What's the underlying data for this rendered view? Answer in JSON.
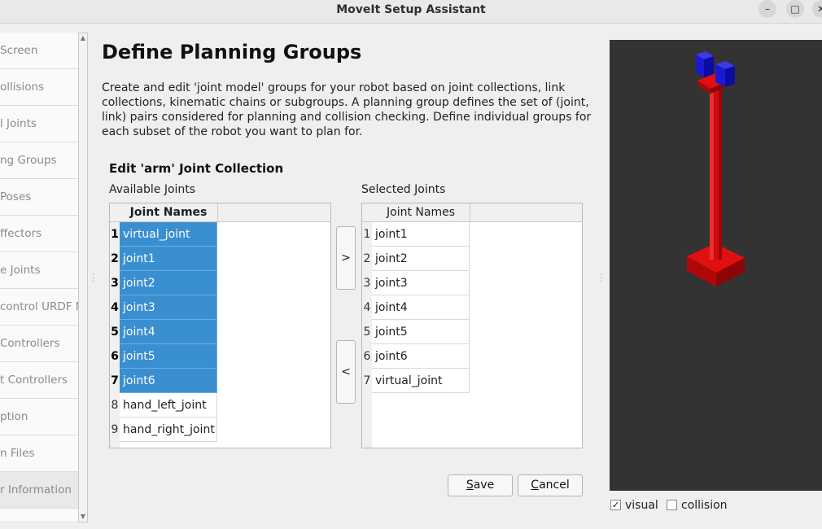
{
  "window": {
    "title": "MoveIt Setup Assistant"
  },
  "steps": [
    {
      "label": "Screen"
    },
    {
      "label": "ollisions"
    },
    {
      "label": "l Joints"
    },
    {
      "label": "ng Groups"
    },
    {
      "label": " Poses"
    },
    {
      "label": "ffectors"
    },
    {
      "label": "e Joints"
    },
    {
      "label": "control URDF M"
    },
    {
      "label": " Controllers"
    },
    {
      "label": "t Controllers"
    },
    {
      "label": "ption"
    },
    {
      "label": "n Files"
    },
    {
      "label": "r Information"
    }
  ],
  "page": {
    "title": "Define Planning Groups",
    "description": "Create and edit 'joint model' groups for your robot based on joint collections, link collections, kinematic chains or subgroups. A planning group defines the set of (joint, link) pairs considered for planning and collision checking. Define individual groups for each subset of the robot you want to plan for.",
    "section_title": "Edit 'arm' Joint Collection"
  },
  "available": {
    "label": "Available Joints",
    "header": "Joint Names",
    "rows": [
      {
        "num": "1",
        "name": "virtual_joint"
      },
      {
        "num": "2",
        "name": "joint1"
      },
      {
        "num": "3",
        "name": "joint2"
      },
      {
        "num": "4",
        "name": "joint3"
      },
      {
        "num": "5",
        "name": "joint4"
      },
      {
        "num": "6",
        "name": "joint5"
      },
      {
        "num": "7",
        "name": "joint6"
      },
      {
        "num": "8",
        "name": "hand_left_joint"
      },
      {
        "num": "9",
        "name": "hand_right_joint"
      }
    ]
  },
  "selected": {
    "label": "Selected Joints",
    "header": "Joint Names",
    "rows": [
      {
        "num": "1",
        "name": "joint1"
      },
      {
        "num": "2",
        "name": "joint2"
      },
      {
        "num": "3",
        "name": "joint3"
      },
      {
        "num": "4",
        "name": "joint4"
      },
      {
        "num": "5",
        "name": "joint5"
      },
      {
        "num": "6",
        "name": "joint6"
      },
      {
        "num": "7",
        "name": "virtual_joint"
      }
    ]
  },
  "buttons": {
    "add": ">",
    "remove": "<",
    "save_first": "S",
    "save_rest": "ave",
    "cancel_first": "C",
    "cancel_rest": "ancel"
  },
  "viewer": {
    "visual_label": "visual",
    "collision_label": "collision",
    "check_mark": "✓",
    "robot_color": "#e01010",
    "gripper_color": "#1a1ad0"
  },
  "titlebar_icons": {
    "minimize": "–",
    "maximize": "□",
    "close": "✕"
  }
}
